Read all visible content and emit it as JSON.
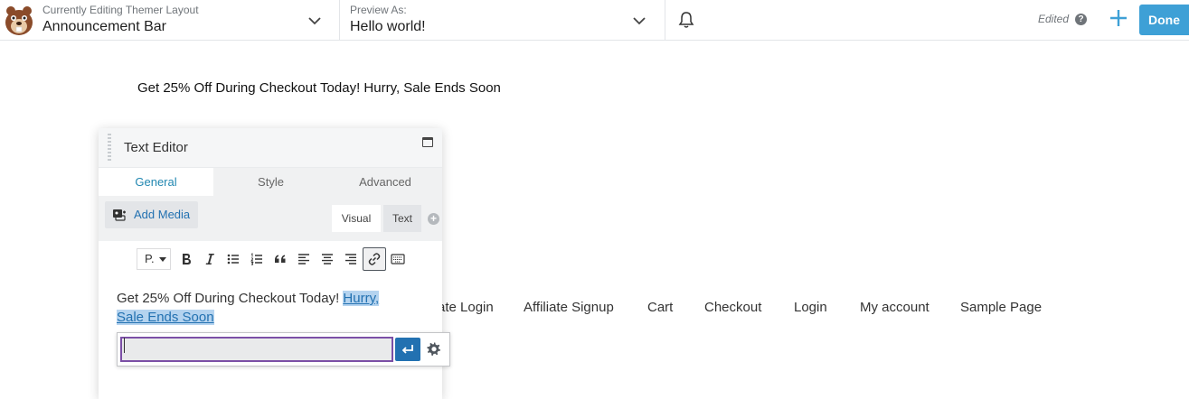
{
  "topbar": {
    "layout_label": "Currently Editing Themer Layout",
    "layout_value": "Announcement Bar",
    "preview_label": "Preview As:",
    "preview_value": "Hello world!",
    "status": "Edited",
    "help_glyph": "?",
    "done_label": "Done",
    "accent_color": "#3ea0d6"
  },
  "page": {
    "announcement": "Get 25% Off During Checkout Today! Hurry, Sale Ends Soon",
    "menu": [
      "ate Login",
      "Affiliate Signup",
      "Cart",
      "Checkout",
      "Login",
      "My account",
      "Sample Page"
    ]
  },
  "editor": {
    "title": "Text Editor",
    "tabs": [
      "General",
      "Style",
      "Advanced"
    ],
    "active_tab": "General",
    "add_media": "Add Media",
    "modes": {
      "visual": "Visual",
      "text": "Text"
    },
    "format_select": "P.",
    "toolbar_icons": [
      "bold-icon",
      "italic-icon",
      "bullet-list-icon",
      "numbered-list-icon",
      "blockquote-icon",
      "align-left-icon",
      "align-center-icon",
      "align-right-icon",
      "link-icon",
      "toolbar-toggle-icon"
    ],
    "content_plain": "Get 25% Off During Checkout Today! ",
    "content_link_line1": "Hurry,",
    "content_link_line2": "Sale Ends Soon",
    "link_input_value": "",
    "link_color": "#2271b1",
    "highlight_color": "#b4d3ef"
  }
}
